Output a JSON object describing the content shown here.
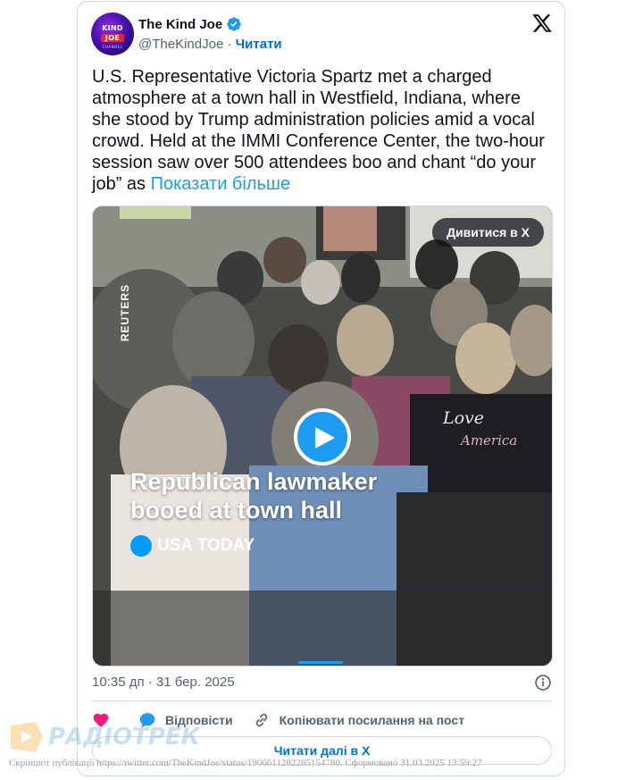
{
  "author": {
    "name": "The Kind Joe",
    "handle": "@TheKindJoe",
    "separator": "·",
    "follow_label": "Читати",
    "avatar_line1": "KIND",
    "avatar_line2": "JOE",
    "avatar_line3": "CHANNEL"
  },
  "tweet": {
    "text": "U.S. Representative Victoria Spartz met a charged atmosphere at a town hall in Westfield, Indiana, where she stood by Trump administration policies amid a vocal crowd. Held at the IMMI Conference Center, the two-hour session saw over 500 attendees boo and chant “do your job” as",
    "show_more": "Показати більше"
  },
  "media": {
    "view_on_x_label": "Дивитися в X",
    "watermark": "REUTERS",
    "headline_line1": "Republican lawmaker",
    "headline_line2": "booed at town hall",
    "source": "USA TODAY",
    "shirt_text_1": "Love",
    "shirt_text_2": "America"
  },
  "meta": {
    "timestamp": "10:35 дп · 31 бер. 2025"
  },
  "actions": {
    "reply_label": "Відповісти",
    "copy_link_label": "Копіювати посилання на пост"
  },
  "read_more_label": "Читати далі в X",
  "watermark": {
    "logo_text": "РАДІОТРЕК",
    "caption": "Скріншот публікації https://twitter.com/TheKindJoe/status/1906611282285154780. Сформовано 31.03.2025 13:59:27"
  },
  "colors": {
    "link": "#1d9bf0",
    "follow": "#006fd6",
    "like": "#f91880",
    "reply": "#1d9bf0"
  }
}
